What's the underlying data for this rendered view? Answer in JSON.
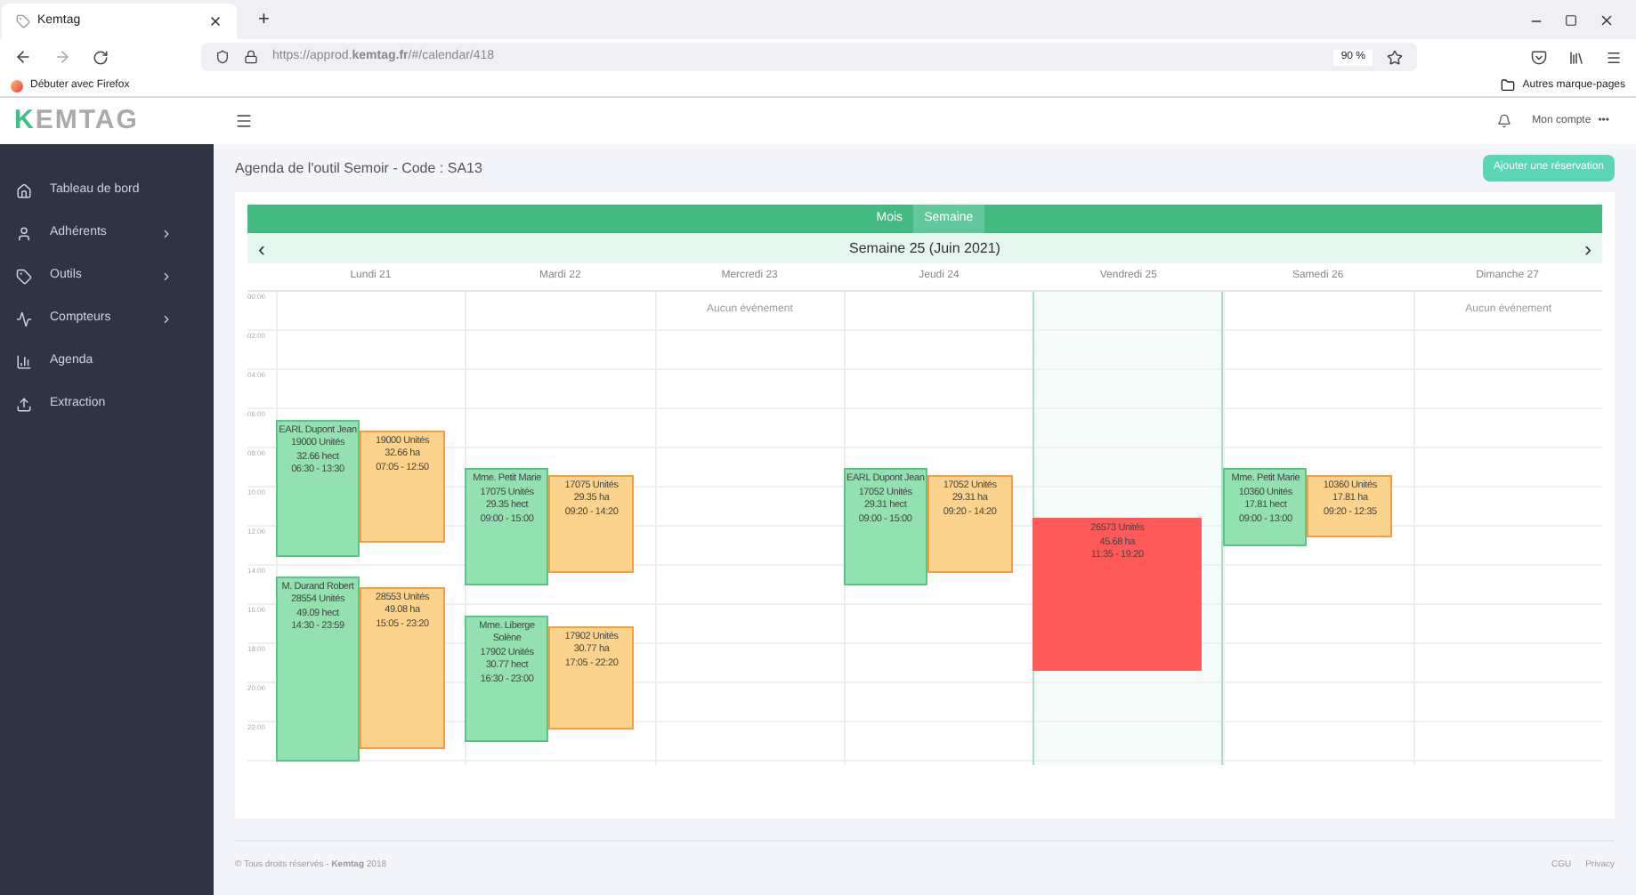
{
  "browser": {
    "tab_title": "Kemtag",
    "new_tab": "+",
    "url": "https://approd.**kemtag.fr**/#/calendar/418",
    "zoom": "90 %",
    "bookmarks": [
      "Débuter avec Firefox"
    ],
    "other_bookmarks": "Autres marque-pages"
  },
  "logo": "KEMTAG",
  "header": {
    "account": "Mon compte",
    "more": "•••"
  },
  "sidebar": {
    "items": [
      {
        "label": "Tableau de bord",
        "has_children": false
      },
      {
        "label": "Adhérents",
        "has_children": true
      },
      {
        "label": "Outils",
        "has_children": true
      },
      {
        "label": "Compteurs",
        "has_children": true
      },
      {
        "label": "Agenda",
        "has_children": false
      },
      {
        "label": "Extraction",
        "has_children": false
      }
    ]
  },
  "page": {
    "title": "Agenda de l'outil Semoir - Code : SA13",
    "add_button": "Ajouter une réservation"
  },
  "calendar": {
    "views": [
      {
        "label": "Mois",
        "selected": false
      },
      {
        "label": "Semaine",
        "selected": true
      }
    ],
    "prev": "‹",
    "next": "›",
    "week_title": "Semaine 25 (Juin 2021)",
    "hours": [
      "00:00",
      "02:00",
      "04:00",
      "06:00",
      "08:00",
      "10:00",
      "12:00",
      "14:00",
      "16:00",
      "18:00",
      "20:00",
      "22:00"
    ],
    "days": [
      {
        "label": "Lundi 21",
        "today": false,
        "events": [
          {
            "kind": "reservation",
            "title": "EARL Dupont Jean",
            "units": "19000 Unités",
            "area": "32.66 hect",
            "time": "06:30 - 13:30"
          },
          {
            "kind": "usage",
            "units": "19000 Unités",
            "area": "32.66 ha",
            "time": "07:05 - 12:50"
          },
          {
            "kind": "reservation",
            "title": "M. Durand Robert",
            "units": "28554 Unités",
            "area": "49.09 hect",
            "time": "14:30 - 23:59"
          },
          {
            "kind": "usage",
            "units": "28553 Unités",
            "area": "49.08 ha",
            "time": "15:05 - 23:20"
          }
        ]
      },
      {
        "label": "Mardi 22",
        "today": false,
        "events": [
          {
            "kind": "reservation",
            "title": "Mme. Petit Marie",
            "units": "17075 Unités",
            "area": "29.35 hect",
            "time": "09:00 - 15:00"
          },
          {
            "kind": "usage",
            "units": "17075 Unités",
            "area": "29.35 ha",
            "time": "09:20 - 14:20"
          },
          {
            "kind": "reservation",
            "title": "Mme. Liberge Solène",
            "units": "17902 Unités",
            "area": "30.77 hect",
            "time": "16:30 - 23:00"
          },
          {
            "kind": "usage",
            "units": "17902 Unités",
            "area": "30.77 ha",
            "time": "17:05 - 22:20"
          }
        ]
      },
      {
        "label": "Mercredi 23",
        "today": false,
        "empty_text": "Aucun événement"
      },
      {
        "label": "Jeudi 24",
        "today": false,
        "events": [
          {
            "kind": "reservation",
            "title": "EARL Dupont Jean",
            "units": "17052 Unités",
            "area": "29.31 hect",
            "time": "09:00 - 15:00"
          },
          {
            "kind": "usage",
            "units": "17052 Unités",
            "area": "29.31 ha",
            "time": "09:20 - 14:20"
          }
        ]
      },
      {
        "label": "Vendredi 25",
        "today": true,
        "events": [
          {
            "kind": "alert",
            "units": "26573 Unités",
            "area": "45.68 ha",
            "time": "11:35 - 19:20"
          }
        ]
      },
      {
        "label": "Samedi 26",
        "today": false,
        "events": [
          {
            "kind": "reservation",
            "title": "Mme. Petit Marie",
            "units": "10360 Unités",
            "area": "17.81 hect",
            "time": "09:00 - 13:00"
          },
          {
            "kind": "usage",
            "units": "10360 Unités",
            "area": "17.81 ha",
            "time": "09:20 - 12:35"
          }
        ]
      },
      {
        "label": "Dimanche 27",
        "today": false,
        "empty_text": "Aucun événement"
      }
    ]
  },
  "footer": {
    "copyright": "© Tous droits réservés - **Kemtag** 2018",
    "links": [
      "CGU",
      "Privacy"
    ]
  }
}
